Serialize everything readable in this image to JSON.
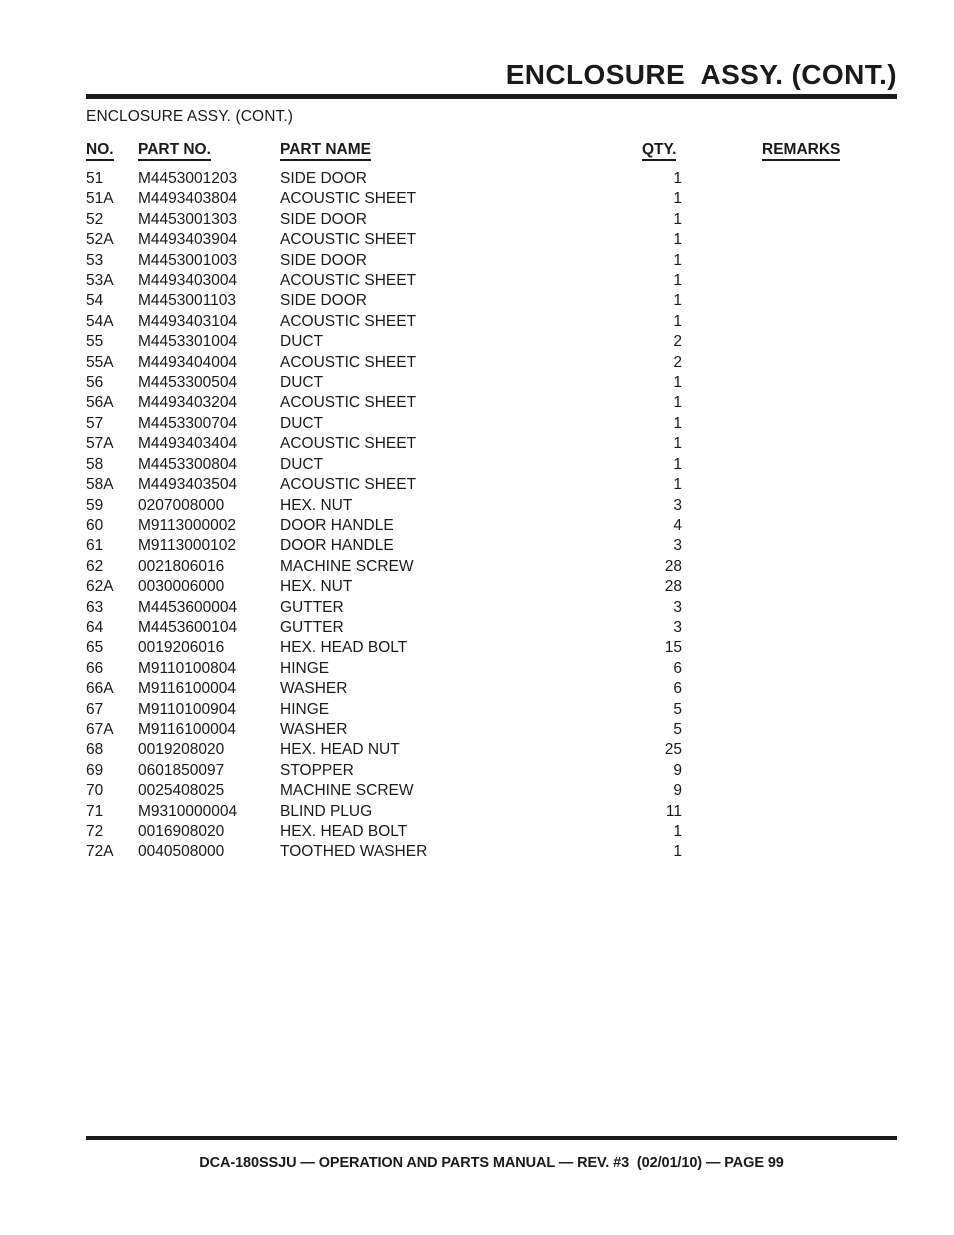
{
  "header": {
    "title": "ENCLOSURE  ASSY. (CONT.)",
    "subtitle": "ENCLOSURE ASSY. (CONT.)"
  },
  "table": {
    "columns": {
      "no": "NO.",
      "part_no": "PART NO.",
      "part_name": "PART NAME",
      "qty": "QTY.",
      "remarks": "REMARKS"
    },
    "rows": [
      {
        "no": "51",
        "part_no": "M4453001203",
        "part_name": "SIDE DOOR",
        "qty": "1",
        "remarks": ""
      },
      {
        "no": "51A",
        "part_no": "M4493403804",
        "part_name": "ACOUSTIC SHEET",
        "qty": "1",
        "remarks": ""
      },
      {
        "no": "52",
        "part_no": "M4453001303",
        "part_name": "SIDE DOOR",
        "qty": "1",
        "remarks": ""
      },
      {
        "no": "52A",
        "part_no": "M4493403904",
        "part_name": "ACOUSTIC SHEET",
        "qty": "1",
        "remarks": ""
      },
      {
        "no": "53",
        "part_no": "M4453001003",
        "part_name": "SIDE DOOR",
        "qty": "1",
        "remarks": ""
      },
      {
        "no": "53A",
        "part_no": "M4493403004",
        "part_name": "ACOUSTIC SHEET",
        "qty": "1",
        "remarks": ""
      },
      {
        "no": "54",
        "part_no": "M4453001103",
        "part_name": "SIDE DOOR",
        "qty": "1",
        "remarks": ""
      },
      {
        "no": "54A",
        "part_no": "M4493403104",
        "part_name": "ACOUSTIC SHEET",
        "qty": "1",
        "remarks": ""
      },
      {
        "no": "55",
        "part_no": "M4453301004",
        "part_name": "DUCT",
        "qty": "2",
        "remarks": ""
      },
      {
        "no": "55A",
        "part_no": "M4493404004",
        "part_name": "ACOUSTIC SHEET",
        "qty": "2",
        "remarks": ""
      },
      {
        "no": "56",
        "part_no": "M4453300504",
        "part_name": "DUCT",
        "qty": "1",
        "remarks": ""
      },
      {
        "no": "56A",
        "part_no": "M4493403204",
        "part_name": "ACOUSTIC SHEET",
        "qty": "1",
        "remarks": ""
      },
      {
        "no": "57",
        "part_no": "M4453300704",
        "part_name": "DUCT",
        "qty": "1",
        "remarks": ""
      },
      {
        "no": "57A",
        "part_no": "M4493403404",
        "part_name": "ACOUSTIC SHEET",
        "qty": "1",
        "remarks": ""
      },
      {
        "no": "58",
        "part_no": "M4453300804",
        "part_name": "DUCT",
        "qty": "1",
        "remarks": ""
      },
      {
        "no": "58A",
        "part_no": "M4493403504",
        "part_name": "ACOUSTIC SHEET",
        "qty": "1",
        "remarks": ""
      },
      {
        "no": "59",
        "part_no": "0207008000",
        "part_name": "HEX. NUT",
        "qty": "3",
        "remarks": ""
      },
      {
        "no": "60",
        "part_no": "M9113000002",
        "part_name": "DOOR HANDLE",
        "qty": "4",
        "remarks": ""
      },
      {
        "no": "61",
        "part_no": "M9113000102",
        "part_name": "DOOR HANDLE",
        "qty": "3",
        "remarks": ""
      },
      {
        "no": "62",
        "part_no": "0021806016",
        "part_name": "MACHINE SCREW",
        "qty": "28",
        "remarks": ""
      },
      {
        "no": "62A",
        "part_no": "0030006000",
        "part_name": "HEX. NUT",
        "qty": "28",
        "remarks": ""
      },
      {
        "no": "63",
        "part_no": "M4453600004",
        "part_name": "GUTTER",
        "qty": "3",
        "remarks": ""
      },
      {
        "no": "64",
        "part_no": "M4453600104",
        "part_name": "GUTTER",
        "qty": "3",
        "remarks": ""
      },
      {
        "no": "65",
        "part_no": "0019206016",
        "part_name": "HEX. HEAD BOLT",
        "qty": "15",
        "remarks": ""
      },
      {
        "no": "66",
        "part_no": "M9110100804",
        "part_name": "HINGE",
        "qty": "6",
        "remarks": ""
      },
      {
        "no": "66A",
        "part_no": "M9116100004",
        "part_name": "WASHER",
        "qty": "6",
        "remarks": ""
      },
      {
        "no": "67",
        "part_no": "M9110100904",
        "part_name": "HINGE",
        "qty": "5",
        "remarks": ""
      },
      {
        "no": "67A",
        "part_no": "M9116100004",
        "part_name": "WASHER",
        "qty": "5",
        "remarks": ""
      },
      {
        "no": "68",
        "part_no": "0019208020",
        "part_name": "HEX. HEAD NUT",
        "qty": "25",
        "remarks": ""
      },
      {
        "no": "69",
        "part_no": "0601850097",
        "part_name": "STOPPER",
        "qty": "9",
        "remarks": ""
      },
      {
        "no": "70",
        "part_no": "0025408025",
        "part_name": "MACHINE SCREW",
        "qty": "9",
        "remarks": ""
      },
      {
        "no": "71",
        "part_no": "M9310000004",
        "part_name": "BLIND PLUG",
        "qty": "11",
        "remarks": ""
      },
      {
        "no": "72",
        "part_no": "0016908020",
        "part_name": "HEX. HEAD BOLT",
        "qty": "1",
        "remarks": ""
      },
      {
        "no": "72A",
        "part_no": "0040508000",
        "part_name": "TOOTHED WASHER",
        "qty": "1",
        "remarks": ""
      }
    ]
  },
  "footer": {
    "text": "DCA-180SSJU — OPERATION AND PARTS MANUAL — REV. #3  (02/01/10) — PAGE 99"
  },
  "colors": {
    "ink": "#1a1a1a",
    "paper": "#ffffff"
  }
}
